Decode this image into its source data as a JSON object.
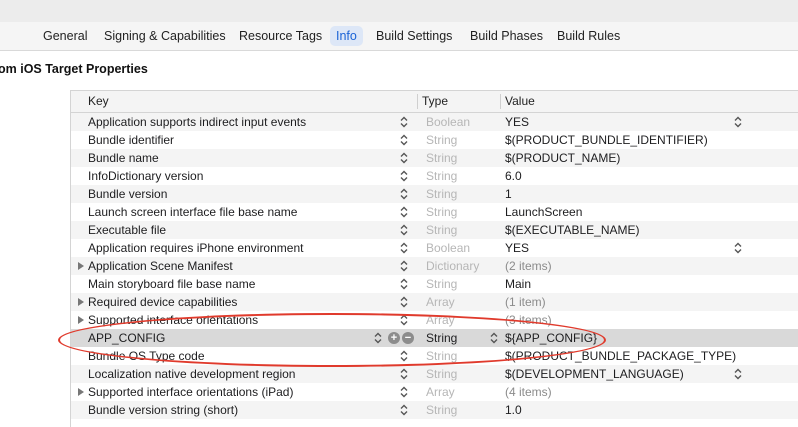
{
  "tabs": [
    {
      "label": "General"
    },
    {
      "label": "Signing & Capabilities"
    },
    {
      "label": "Resource Tags"
    },
    {
      "label": "Info"
    },
    {
      "label": "Build Settings"
    },
    {
      "label": "Build Phases"
    },
    {
      "label": "Build Rules"
    }
  ],
  "section_title": "om iOS Target Properties",
  "columns": {
    "key": "Key",
    "type": "Type",
    "value": "Value"
  },
  "rows": [
    {
      "key": "Application supports indirect input events",
      "type": "Boolean",
      "value": "YES"
    },
    {
      "key": "Bundle identifier",
      "type": "String",
      "value": "$(PRODUCT_BUNDLE_IDENTIFIER)"
    },
    {
      "key": "Bundle name",
      "type": "String",
      "value": "$(PRODUCT_NAME)"
    },
    {
      "key": "InfoDictionary version",
      "type": "String",
      "value": "6.0"
    },
    {
      "key": "Bundle version",
      "type": "String",
      "value": "1"
    },
    {
      "key": "Launch screen interface file base name",
      "type": "String",
      "value": "LaunchScreen"
    },
    {
      "key": "Executable file",
      "type": "String",
      "value": "$(EXECUTABLE_NAME)"
    },
    {
      "key": "Application requires iPhone environment",
      "type": "Boolean",
      "value": "YES"
    },
    {
      "key": "Application Scene Manifest",
      "type": "Dictionary",
      "value": "(2 items)"
    },
    {
      "key": "Main storyboard file base name",
      "type": "String",
      "value": "Main"
    },
    {
      "key": "Required device capabilities",
      "type": "Array",
      "value": "(1 item)"
    },
    {
      "key": "Supported interface orientations",
      "type": "Array",
      "value": "(3 items)"
    },
    {
      "key": "APP_CONFIG",
      "type": "String",
      "value": "${APP_CONFIG}"
    },
    {
      "key": "Bundle OS Type code",
      "type": "String",
      "value": "$(PRODUCT_BUNDLE_PACKAGE_TYPE)"
    },
    {
      "key": "Localization native development region",
      "type": "String",
      "value": "$(DEVELOPMENT_LANGUAGE)"
    },
    {
      "key": "Supported interface orientations (iPad)",
      "type": "Array",
      "value": "(4 items)"
    },
    {
      "key": "Bundle version string (short)",
      "type": "String",
      "value": "1.0"
    }
  ],
  "selected_row_buttons": {
    "add": "+",
    "remove": "−"
  },
  "colors": {
    "accent": "#1a63d6",
    "highlight_ellipse": "#e03a2c",
    "selected_row": "#d9d9d9"
  }
}
